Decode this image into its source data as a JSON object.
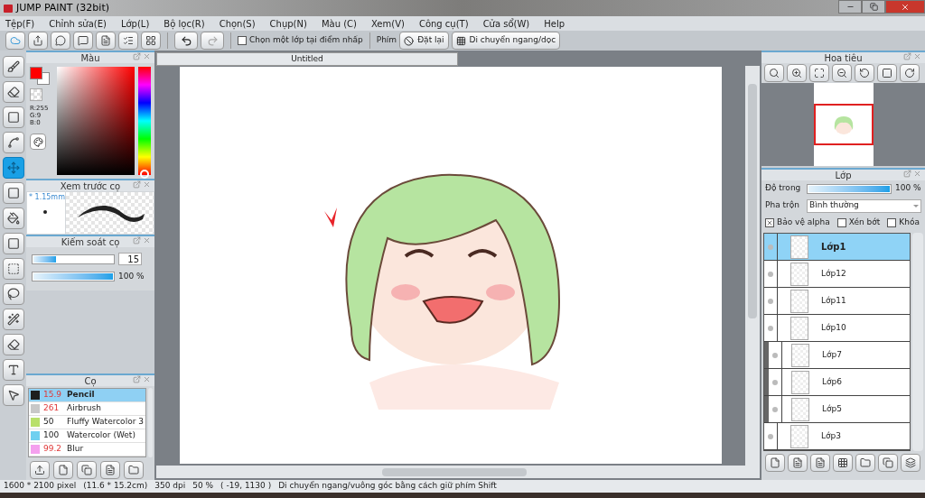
{
  "window": {
    "title": "JUMP PAINT (32bit)"
  },
  "menu": [
    "Tệp(F)",
    "Chỉnh sửa(E)",
    "Lớp(L)",
    "Bộ lọc(R)",
    "Chọn(S)",
    "Chụp(N)",
    "Màu (C)",
    "Xem(V)",
    "Công cụ(T)",
    "Cửa sổ(W)",
    "Help"
  ],
  "toolbar": {
    "select_layer_on_click": {
      "label": "Chọn một lớp tại điểm nhấp",
      "checked": false
    },
    "keys_label": "Phím",
    "reset_button": "Đặt lại",
    "move_button": "Di chuyển ngang/dọc"
  },
  "tools": [
    {
      "selected": false
    },
    {
      "selected": false
    },
    {
      "selected": false
    },
    {
      "selected": false
    },
    {
      "selected": true
    },
    {
      "selected": false
    },
    {
      "selected": false
    },
    {
      "selected": false
    },
    {
      "selected": false
    },
    {
      "selected": false
    },
    {
      "selected": false
    },
    {
      "selected": false
    },
    {
      "selected": false
    },
    {
      "selected": false
    }
  ],
  "color_panel": {
    "title": "Màu",
    "r": "R:255",
    "g": "G:9",
    "b": "B:0",
    "hue_slider": {
      "level": 0.0
    }
  },
  "brush_preview": {
    "title": "Xem trước cọ",
    "size": "* 1.15mm"
  },
  "brush_control": {
    "title": "Kiếm soát cọ",
    "size_slider": {
      "level": 0.28
    },
    "size_value": "15",
    "opacity_slider": {
      "level": 1.0
    },
    "opacity_value": "100 %"
  },
  "brushes": {
    "title": "Cọ",
    "items": [
      {
        "size": "15.9",
        "name": "Pencil",
        "color": "#1e1e1e",
        "size_alert": true,
        "selected": true
      },
      {
        "size": "261",
        "name": "Airbrush",
        "color": "#c8c8c8",
        "size_alert": true,
        "selected": false
      },
      {
        "size": "50",
        "name": "Fluffy Watercolor 3",
        "color": "#b8e06a",
        "size_alert": false,
        "selected": false
      },
      {
        "size": "100",
        "name": "Watercolor (Wet)",
        "color": "#6fd0f0",
        "size_alert": false,
        "selected": false
      },
      {
        "size": "99.2",
        "name": "Blur",
        "color": "#f4a0ee",
        "size_alert": true,
        "selected": false
      }
    ]
  },
  "canvas": {
    "tab": "Untitled"
  },
  "navigator": {
    "title": "Hoa tiêu"
  },
  "layers": {
    "title": "Lớp",
    "opacity_label": "Độ trong",
    "opacity_slider": {
      "level": 1.0
    },
    "opacity_value": "100 %",
    "blend_label": "Pha trộn",
    "blend_value": "Bình thường",
    "options": [
      {
        "label": "Bảo vệ alpha",
        "checked": true
      },
      {
        "label": "Xén bớt",
        "checked": false
      },
      {
        "label": "Khóa",
        "checked": false
      }
    ],
    "items": [
      {
        "name": "Lớp1",
        "selected": true,
        "clipped": false
      },
      {
        "name": "Lớp12",
        "selected": false,
        "clipped": false
      },
      {
        "name": "Lớp11",
        "selected": false,
        "clipped": false
      },
      {
        "name": "Lớp10",
        "selected": false,
        "clipped": false
      },
      {
        "name": "Lớp7",
        "selected": false,
        "clipped": true
      },
      {
        "name": "Lớp6",
        "selected": false,
        "clipped": true
      },
      {
        "name": "Lớp5",
        "selected": false,
        "clipped": true
      },
      {
        "name": "Lớp3",
        "selected": false,
        "clipped": false
      }
    ]
  },
  "status_bar": [
    "1600 * 2100 pixel",
    "(11.6 * 15.2cm)",
    "350 dpi",
    "50 %",
    "( -19, 1130 )",
    "Di chuyển ngang/vuông góc bằng cách giữ phím Shift"
  ]
}
